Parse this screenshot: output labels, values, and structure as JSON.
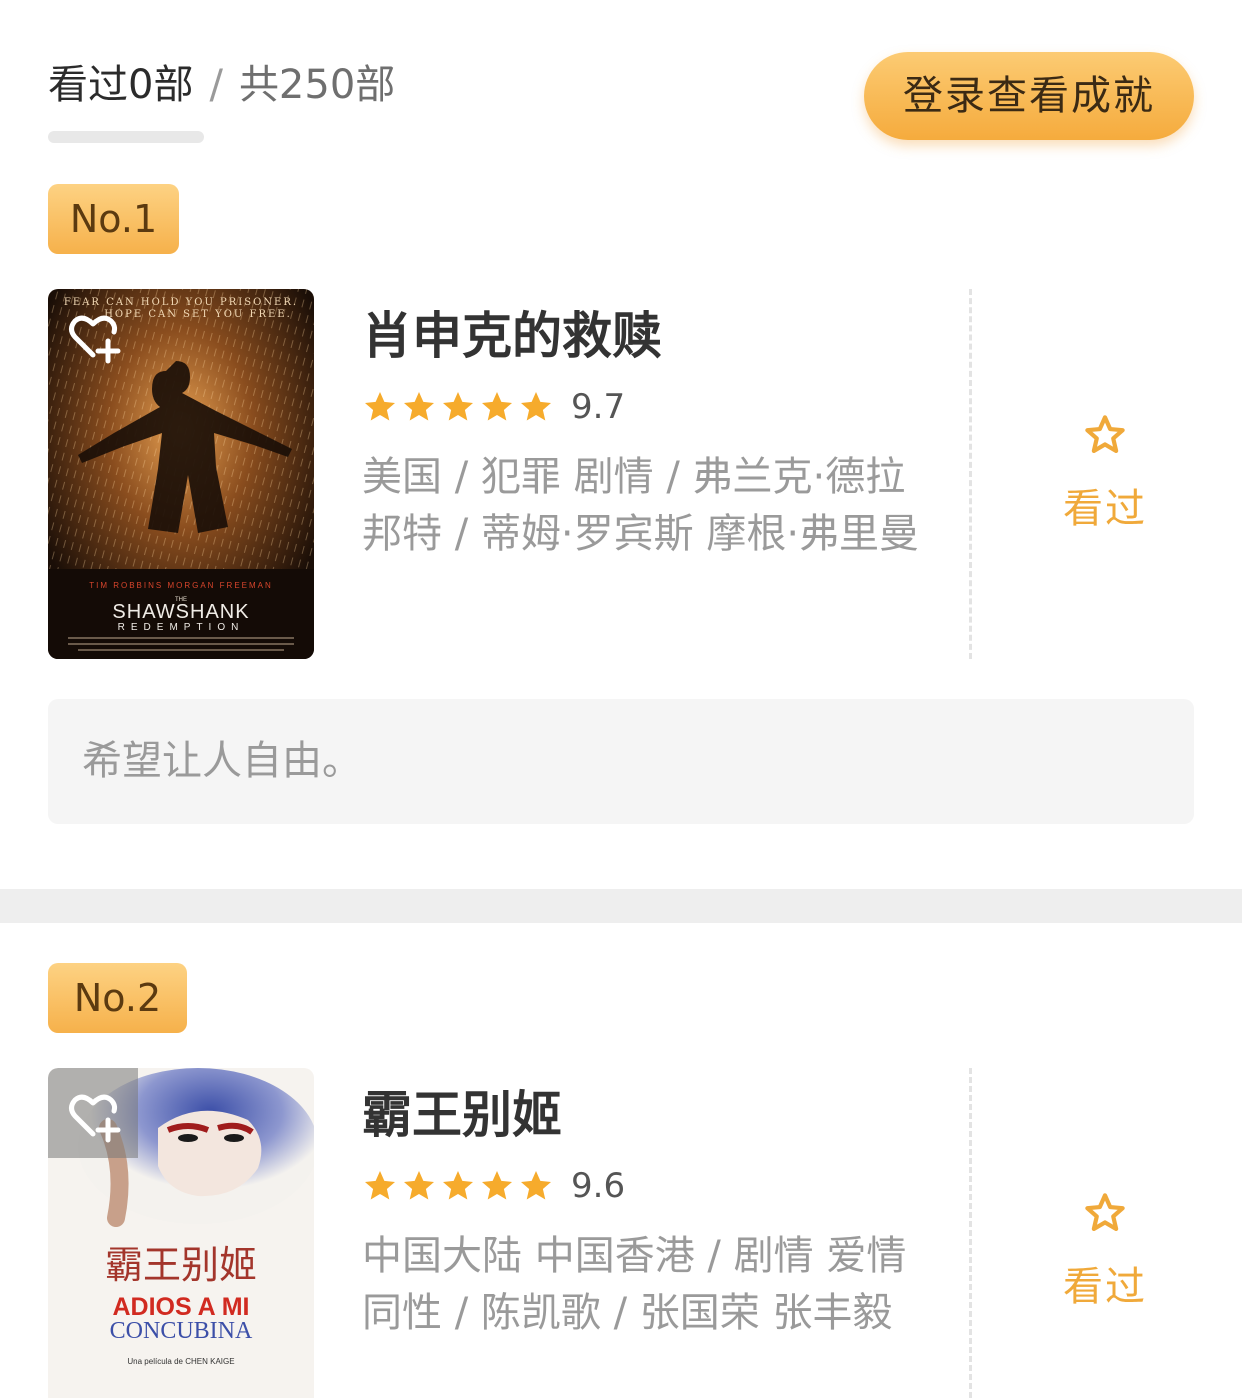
{
  "header": {
    "watched_text": "看过0部",
    "separator": "/",
    "total_text": "共250部",
    "progress_value": 0,
    "login_button": "登录查看成就"
  },
  "colors": {
    "accent": "#f5ab3d",
    "star": "#f6ab2c",
    "seen_label": "#f0a93a",
    "meta_text": "#9a9a9a"
  },
  "movies": [
    {
      "rank": "No.1",
      "title": "肖申克的救赎",
      "stars": 5,
      "score": "9.7",
      "meta": "美国 / 犯罪 剧情 / 弗兰克·德拉邦特 / 蒂姆·罗宾斯 摩根·弗里曼",
      "seen_label": "看过",
      "quote": "希望让人自由。",
      "poster": {
        "tagline_1": "FEAR CAN HOLD YOU PRISONER.",
        "tagline_2": "HOPE CAN SET YOU FREE.",
        "actors": "TIM ROBBINS    MORGAN FREEMAN",
        "title_small": "THE",
        "title_main": "SHAWSHANK",
        "title_sub": "REDEMPTION"
      }
    },
    {
      "rank": "No.2",
      "title": "霸王别姬",
      "stars": 5,
      "score": "9.6",
      "meta": "中国大陆 中国香港 / 剧情 爱情 同性 / 陈凯歌 / 张国荣 张丰毅",
      "seen_label": "看过",
      "poster": {
        "title_cn": "霸王别姬",
        "title_es_1": "ADIOS A MI",
        "title_es_2": "CONCUBINA",
        "credit": "Una película de CHEN KAIGE"
      }
    }
  ],
  "icons": {
    "favorite_add": "heart-plus-icon",
    "rating_star": "star-icon",
    "seen_star": "star-outline-icon"
  }
}
